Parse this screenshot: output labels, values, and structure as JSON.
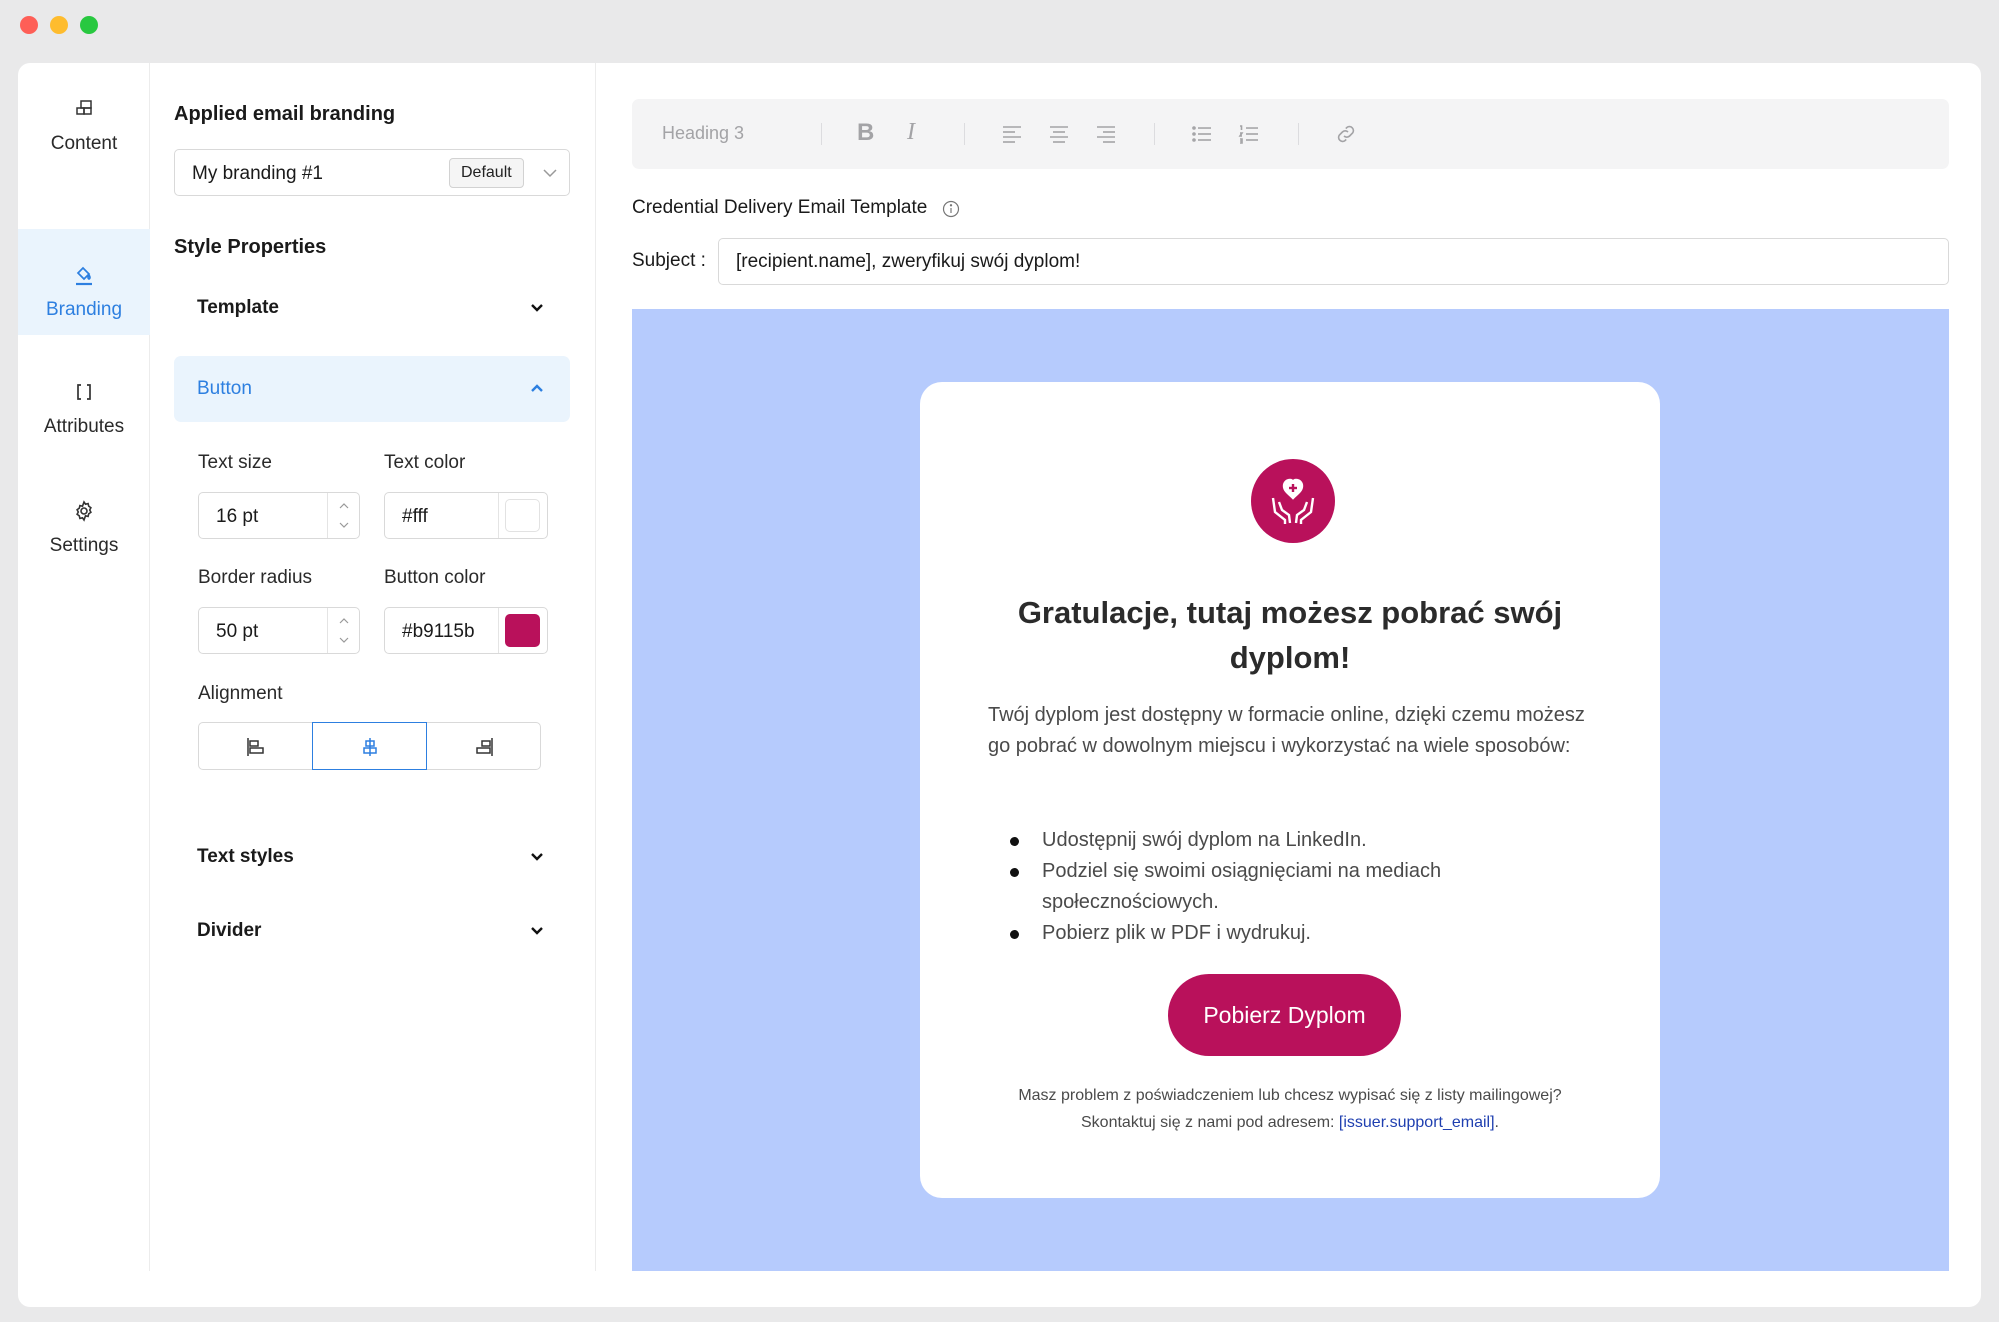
{
  "nav": {
    "items": [
      {
        "label": "Content",
        "icon": "content-blocks-icon"
      },
      {
        "label": "Branding",
        "icon": "paint-bucket-icon",
        "active": true
      },
      {
        "label": "Attributes",
        "icon": "brackets-icon"
      },
      {
        "label": "Settings",
        "icon": "gear-icon"
      }
    ]
  },
  "panel": {
    "branding_title": "Applied email branding",
    "branding_value": "My branding #1",
    "branding_badge": "Default",
    "style_title": "Style Properties",
    "sections": {
      "template": "Template",
      "button": "Button",
      "text_styles": "Text styles",
      "divider": "Divider"
    },
    "button": {
      "text_size_label": "Text size",
      "text_size_value": "16 pt",
      "text_color_label": "Text color",
      "text_color_value": "#fff",
      "border_radius_label": "Border radius",
      "border_radius_value": "50 pt",
      "button_color_label": "Button color",
      "button_color_value": "#b9115b",
      "alignment_label": "Alignment",
      "alignment_selected": "center"
    }
  },
  "editor": {
    "toolbar": {
      "heading_select": "Heading 3",
      "bold": "B",
      "italic": "I"
    },
    "template_title": "Credential Delivery Email Template",
    "subject_label": "Subject :",
    "subject_value": "[recipient.name], zweryfikuj swój dyplom!"
  },
  "email": {
    "heading": "Gratulacje, tutaj możesz pobrać swój dyplom!",
    "body": "Twój dyplom jest dostępny w formacie online, dzięki czemu możesz go pobrać w dowolnym miejscu i wykorzystać na wiele sposobów:",
    "bullets": [
      "Udostępnij swój dyplom na LinkedIn.",
      "Podziel się swoimi osiągnięciami na mediach społecznościowych.",
      "Pobierz plik w PDF i wydrukuj."
    ],
    "cta": "Pobierz Dyplom",
    "footer_line1": "Masz problem z poświadczeniem lub chcesz wypisać się z listy mailingowej?",
    "footer_line2_prefix": "Skontaktuj się z nami pod adresem: ",
    "footer_link": "[issuer.support_email]",
    "footer_line2_suffix": "."
  },
  "colors": {
    "accent": "#2d7fe0",
    "button": "#b9115b",
    "canvas_bg": "#b6cbfd",
    "link": "#1f3fb0"
  }
}
